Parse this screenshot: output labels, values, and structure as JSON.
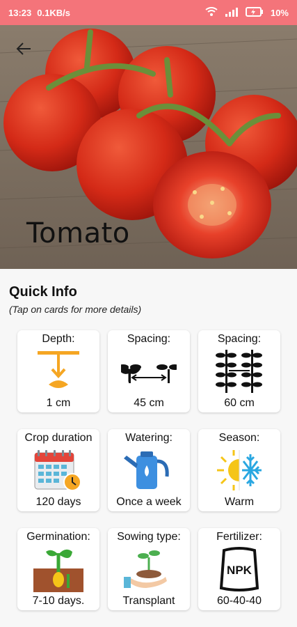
{
  "status_bar": {
    "time": "13:23",
    "speed": "0.1KB/s",
    "battery": "10%",
    "icons": [
      "wifi-icon",
      "signal-icon",
      "battery-icon"
    ]
  },
  "header": {
    "back_icon": "back-arrow-icon",
    "title": "Tomato"
  },
  "quick_info": {
    "title": "Quick Info",
    "subtitle": "(Tap on cards for more details)",
    "cards": [
      {
        "label": "Depth:",
        "value": "1 cm",
        "icon": "depth-icon"
      },
      {
        "label": "Spacing:",
        "value": "45 cm",
        "icon": "plant-spacing-icon"
      },
      {
        "label": "Spacing:",
        "value": "60 cm",
        "icon": "row-spacing-icon"
      },
      {
        "label": "Crop duration",
        "value": "120 days",
        "icon": "calendar-icon"
      },
      {
        "label": "Watering:",
        "value": "Once a week",
        "icon": "watering-can-icon"
      },
      {
        "label": "Season:",
        "value": "Warm",
        "icon": "sun-snow-icon"
      },
      {
        "label": "Germination:",
        "value": "7-10 days.",
        "icon": "germination-icon"
      },
      {
        "label": "Sowing type:",
        "value": "Transplant",
        "icon": "sowing-hand-icon"
      },
      {
        "label": "Fertilizer:",
        "value": "60-40-40",
        "icon": "fertilizer-bag-icon"
      }
    ],
    "fertilizer_bag_text": "NPK"
  },
  "colors": {
    "status_bar": "#f4747a",
    "accent_orange": "#f5a623",
    "water_blue": "#3d8fe0"
  }
}
